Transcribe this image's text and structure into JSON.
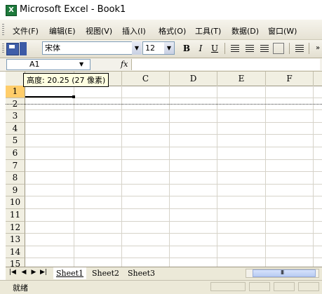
{
  "window": {
    "title": "Microsoft Excel - Book1",
    "app_icon_letter": "X"
  },
  "menu": {
    "items": [
      "文件(F)",
      "编辑(E)",
      "视图(V)",
      "插入(I)",
      "格式(O)",
      "工具(T)",
      "数据(D)",
      "窗口(W)"
    ]
  },
  "toolbar": {
    "font_name": "宋体",
    "font_size": "12",
    "bold_label": "B",
    "italic_label": "I",
    "underline_label": "U"
  },
  "formula_bar": {
    "name_box": "A1",
    "fx_label": "fx",
    "formula": ""
  },
  "grid": {
    "columns": [
      "C",
      "D",
      "E",
      "F"
    ],
    "rows": [
      "1",
      "2",
      "3",
      "4",
      "5",
      "6",
      "7",
      "8",
      "9",
      "10",
      "11",
      "12",
      "13",
      "14",
      "15"
    ],
    "tooltip": "高度: 20.25 (27 像素)"
  },
  "sheets": {
    "nav_buttons": [
      "|◀",
      "◀",
      "▶",
      "▶|"
    ],
    "tabs": [
      "Sheet1",
      "Sheet2",
      "Sheet3"
    ],
    "scroll_glyph": "III"
  },
  "status": {
    "text": "就绪"
  },
  "colors": {
    "active_row_header": "#ffcd6a",
    "excel_green": "#1e7a3c",
    "toolbar_bg": "#ece9d8"
  }
}
